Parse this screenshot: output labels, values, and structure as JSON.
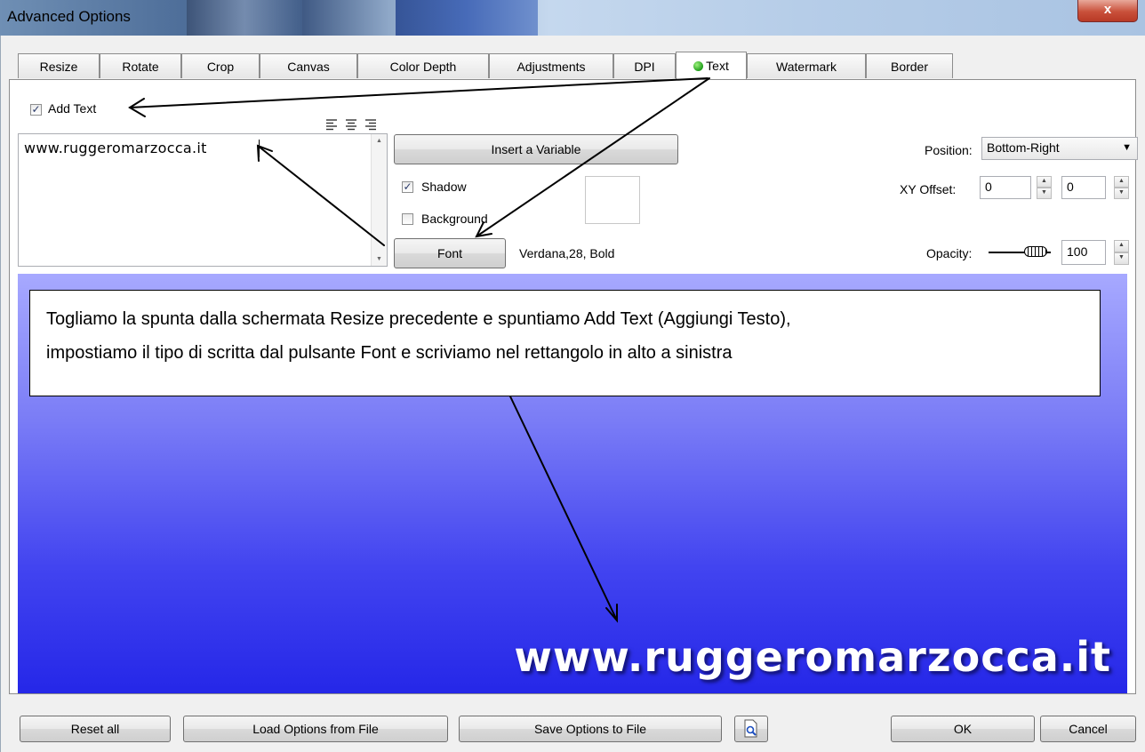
{
  "window": {
    "title": "Advanced Options",
    "close_glyph": "x"
  },
  "tabs": [
    {
      "label": "Resize"
    },
    {
      "label": "Rotate"
    },
    {
      "label": "Crop"
    },
    {
      "label": "Canvas"
    },
    {
      "label": "Color Depth"
    },
    {
      "label": "Adjustments"
    },
    {
      "label": "DPI"
    },
    {
      "label": "Text",
      "active": true,
      "status_icon": "green-dot-icon"
    },
    {
      "label": "Watermark"
    },
    {
      "label": "Border"
    }
  ],
  "text_tab": {
    "add_text_label": "Add Text",
    "add_text_checked": true,
    "align_icons": [
      "align-left-icon",
      "align-center-icon",
      "align-right-icon"
    ],
    "text_value": "www.ruggeromarzocca.it",
    "insert_variable_label": "Insert a Variable",
    "shadow_label": "Shadow",
    "shadow_checked": true,
    "background_label": "Background",
    "background_checked": false,
    "font_button_label": "Font",
    "font_description": "Verdana,28, Bold",
    "position_label": "Position:",
    "position_value": "Bottom-Right",
    "xy_offset_label": "XY Offset:",
    "x_offset": "0",
    "y_offset": "0",
    "opacity_label": "Opacity:",
    "opacity_value": "100"
  },
  "preview": {
    "watermark_text": "www.ruggeromarzocca.it",
    "colors": {
      "top": "#a7a9ff",
      "bottom": "#2527e8"
    }
  },
  "callout": {
    "line1": "Togliamo la spunta dalla schermata Resize precedente e spuntiamo Add Text (Aggiungi Testo),",
    "line2": "impostiamo il tipo di scritta dal pulsante Font e scriviamo nel rettangolo in alto a sinistra"
  },
  "bottom_bar": {
    "reset_label": "Reset all",
    "load_label": "Load Options from File",
    "save_label": "Save Options to File",
    "preview_icon": "magnifier-icon",
    "ok_label": "OK",
    "cancel_label": "Cancel"
  }
}
